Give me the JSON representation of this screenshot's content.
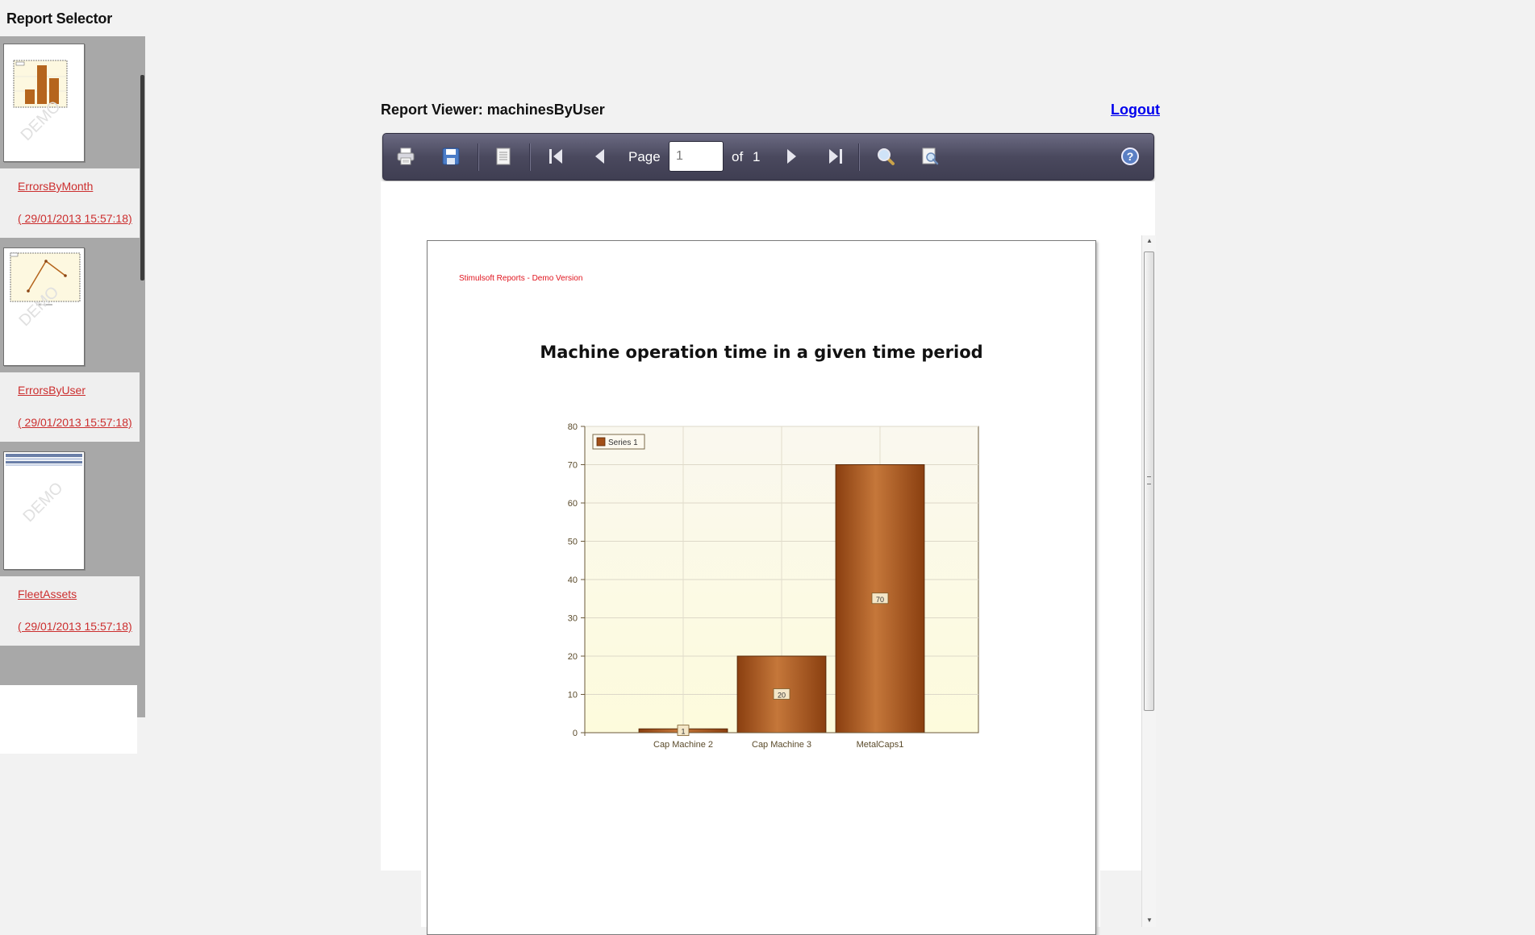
{
  "sidebar": {
    "title": "Report Selector",
    "items": [
      {
        "name": "ErrorsByMonth",
        "date": "( 29/01/2013 15:57:18)",
        "thumb_watermark": "DEMO"
      },
      {
        "name": "ErrorsByUser",
        "date": "( 29/01/2013 15:57:18)",
        "thumb_watermark": "DEMO"
      },
      {
        "name": "FleetAssets",
        "date": "( 29/01/2013 15:57:18)",
        "thumb_watermark": "DEMO"
      }
    ]
  },
  "header": {
    "title": "Report Viewer: machinesByUser",
    "logout": "Logout"
  },
  "toolbar": {
    "icons": [
      "print-icon",
      "save-icon",
      "page-view-icon",
      "first-page-icon",
      "previous-page-icon",
      "next-page-icon",
      "last-page-icon",
      "zoom-icon",
      "find-icon",
      "help-icon"
    ],
    "page_label": "Page",
    "page_value": "1",
    "of_label": "of",
    "total_pages": "1"
  },
  "report": {
    "watermark": "Stimulsoft Reports - Demo Version",
    "title": "Machine operation time in a given time period"
  },
  "colors": {
    "link": "#cc2e2e",
    "toolbar": "#4a495e",
    "bar": "#b5651d",
    "plot_background": "#fdfbe8"
  },
  "chart_data": {
    "type": "bar",
    "categories": [
      "Cap Machine 2",
      "Cap Machine 3",
      "MetalCaps1"
    ],
    "series": [
      {
        "name": "Series 1",
        "values": [
          1,
          20,
          70
        ]
      }
    ],
    "data_labels": [
      "1",
      "20",
      "70"
    ],
    "yticks": [
      "0",
      "10",
      "20",
      "30",
      "40",
      "50",
      "60",
      "70",
      "80"
    ],
    "ylim": [
      0,
      80
    ],
    "grid": true,
    "legend": "top-left"
  }
}
